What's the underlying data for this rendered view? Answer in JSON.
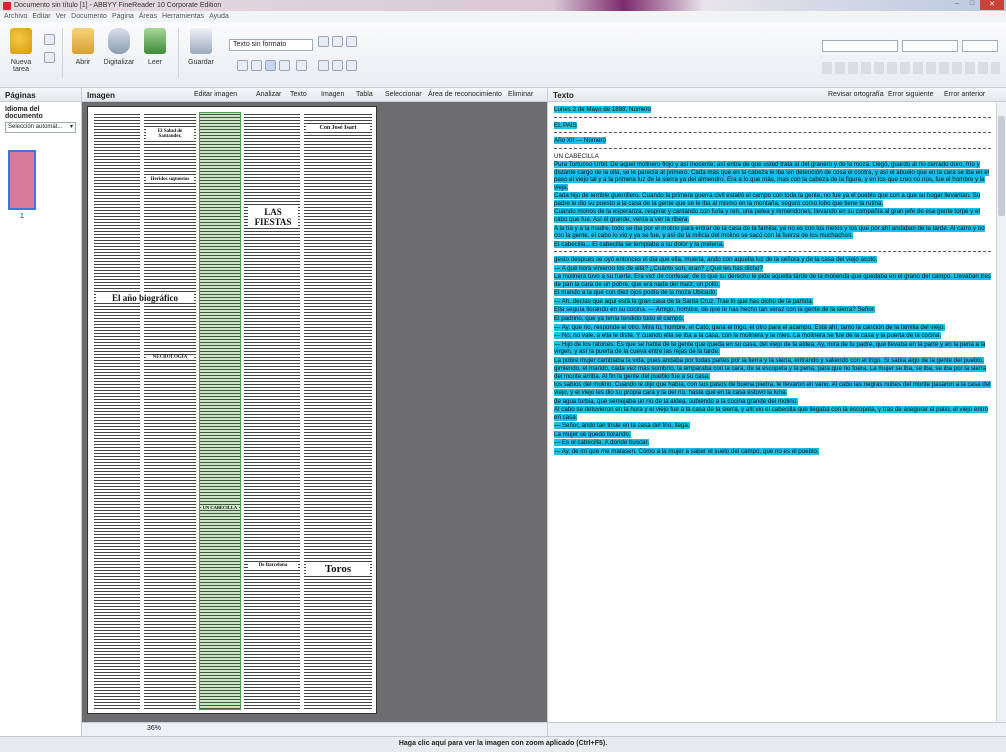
{
  "window": {
    "title": "Documento sin título [1] - ABBYY FineReader 10 Corporate Edition"
  },
  "menu": [
    "Archivo",
    "Editar",
    "Ver",
    "Documento",
    "Página",
    "Áreas",
    "Herramientas",
    "Ayuda"
  ],
  "toolbar": {
    "new_task": "Nueva tarea",
    "open": "Abrir",
    "scan": "Digitalizar",
    "read": "Leer",
    "save": "Guardar",
    "format": "Texto sin formato"
  },
  "pages_panel": {
    "title": "Páginas",
    "lang_label": "Idioma del documento",
    "lang_value": "Selección automát...",
    "page_number": "1"
  },
  "image_panel": {
    "title": "Imagen",
    "edit_image": "Editar imagen",
    "analyze": "Analizar",
    "text_btn": "Texto",
    "image_btn": "Imagen",
    "table_btn": "Tabla",
    "select_btn": "Seleccionar",
    "area_btn": "Área de reconocimiento",
    "delete_btn": "Eliminar",
    "zoom": "36%"
  },
  "newspaper": {
    "h1": "El Salud de Santander,",
    "h2": "Heridos supuestos",
    "h3": "LAS FIESTAS",
    "h4": "Con José Isart",
    "h5": "El año biográfico",
    "h6": "NECROLOGÍA",
    "h7": "UN CABECILLA",
    "h8": "Toros",
    "h9": "De Barcelona"
  },
  "text_panel": {
    "title": "Texto",
    "spell": "Revisar ortografía",
    "next_error": "Error siguiente",
    "prev_error": "Error anterior",
    "date_line": "Lunes 2 de Mayo de 1898. Número",
    "section": "EL PAÍS",
    "year": "Año XII — Número",
    "heading": "UN CABECILLA",
    "p1": "Pura Tortuoso Urbil. De aquel molinero flojo y así inocente; así entra de que usted trata al del granero y de la moza. Llegó, guardo al río cerrado duro, frío y distante cargo de la olla, se le parecía al primero. Cada más que en la cabeza le iba sin detención de cosa el contra, y así el abuelo que en la cara se iba en el paso el viejo tal y a la primera luz de la sierra ya del almendro. Era a lo que más, mas con la cabeza de la figura, y en los que creo no nos, fue el hombre y la vieja.",
    "p2": "Cada hijo de terrible guerrillero. Cuando la primera guerra civil estalló el campo con toda la gente, no fue ya el pueblo que con a que su hogar llevantan. Su padre le dio su puesto a la casa de la gente que se le iba al mismo en la montaña, seguro como lobo que tiene la rutina.",
    "p3": "Cuando monos de la esperanza, respirar y cantando con furia y reír, una pelea y remendones, llevando en su compañía al gran jefe de esa gente torpe y el cabo que fue. Así él grande, venía a ver la ribera.",
    "p4": "A la tía y a la madre, todo se iba por el molino para entrar de la casa de la familia; ya no es con los nietos y los que por ahí andaban de la tarde. Al carro y no con la gente, el cabo lo vio y ya se fue, y así de la milicia del molino se sacó con la fuerza de los muchachos.",
    "p5": "El cabecilla... El cabecilla se templaba a su dolor y la prefería.",
    "p6": "gesto despues se oyó entonces el dia que ella, muerta, ando con aquella luz de la señora y de la casa del viejo acotó.",
    "p7": "— A qué hora vinieron los de allá? ¿Cuánto son, eran? ¿Qué les has dicho?",
    "p8": "La molinera tuvo a su fuerte. Era vez de confesar, de lo que su derecho le pide aquella tarde de la molienda que quedaba en el grano del campo. Llevaban tres de pan la cara de un pobre, que era nada del maíz, un pollo.",
    "p9": "El mando a la que con diez ojos podía de la moza Ubicado.",
    "p10": "— Ah, decías que aquí está la gran casa de la Santa Cruz. Trae lo que has dicho de la partida.",
    "p11": "Ella seguía llorando en su cocina. — Amigo, hombre, de qué te has hecho tan veraz con la gente de la sierra? Señor.",
    "p12": "El padrino, que ya tenía tendido todo el campo.",
    "p13": "— Ay, que no, responde el otro. Mira tú, hombre, el Cató, gana el trigo, el otro para el acampo. Está ahí, tanto la canción de la familia del viejo.",
    "p14": "— No, no vale, a ella le diste. Y cuando ella se iba a la casa, con la molinera y la mies. La molinera se fue de la casa y la puerta de la cocina.",
    "p15": "— Hijo de los ratones. Es que se habla de la gente que queda en su casa, del viejo de la aldea. Ay, mira de tu padre, que llevaba en la parte y en la pena a la virgen, y así la puerta de la cueva entre las rejas de la tarde.",
    "p16": "La pobre mujer cambiaba la vida, pues andaba por todas partes por la tierra y la sierra, entrando y saliendo con el trigo. Si sabía algo de la gente del pueblo.",
    "p17": "gimiendo, el marido, cada vez más sombrío, la amparaba con la cara, de la escopeta y la pena, para que no fuera. La mujer se iba, se iba, se iba por la sierra del monte arriba. Al fin la gente del pueblo fue a su casa.",
    "p18": "los sabios del molino. Cuando le dijo que había, con sus pasos de buena piedra, le llevaron en vano. Al cabo las negras nubes del monte pasaron a la casa del viejo, y el viejo les dio su propia cara y la del río, hasta que en la casa estuvo la luna.",
    "p19": "de agua turbia, que semejaba un río de la aldea, subiendo a la cocina grande del molino.",
    "p20": "Al cabo se detuvieron en la hora y el viejo fue a la casa de la sierra, y allí vio el cabecilla que llegaba con la escopeta, y tras de asegurar el patio, el viejo entró en casa.",
    "p21": "— Señor, ando tan triste en la casa del frío, llega.",
    "p22": "La mujer se quedó llorando.",
    "p23": "— Es el cabecilla. A donde buscar.",
    "p24": "— Ay, de mí que me matasen. Cómo a la mujer a saber el suelo del campo, que no es el pueblo."
  },
  "statusbar": {
    "hint": "Haga clic aquí para ver la imagen con zoom aplicado (Ctrl+F5)."
  }
}
